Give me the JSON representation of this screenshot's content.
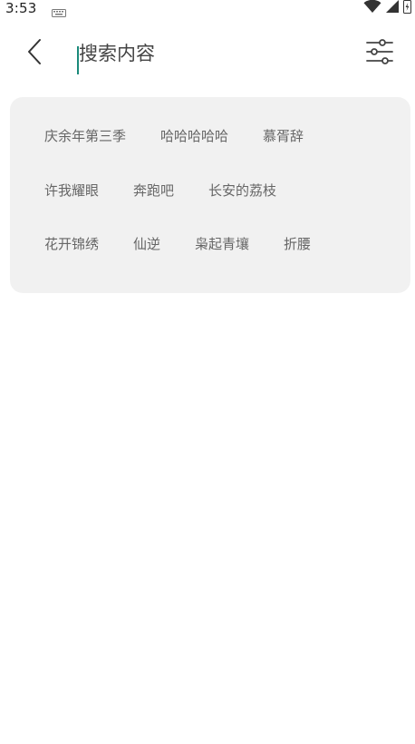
{
  "status_bar": {
    "time": "3:53",
    "icons": [
      "keyboard-icon",
      "wifi-icon",
      "signal-icon",
      "battery-icon"
    ]
  },
  "header": {
    "back_icon": "chevron-left-icon",
    "search_placeholder": "搜索内容",
    "search_value": "",
    "filter_icon": "sliders-icon",
    "caret_color": "#1a8a7a"
  },
  "suggestions": {
    "rows": [
      [
        "庆余年第三季",
        "哈哈哈哈哈",
        "慕胥辞"
      ],
      [
        "许我耀眼",
        "奔跑吧",
        "长安的荔枝"
      ],
      [
        "花开锦绣",
        "仙逆",
        "枭起青壤",
        "折腰"
      ]
    ],
    "card_color": "#f1f1f1"
  }
}
